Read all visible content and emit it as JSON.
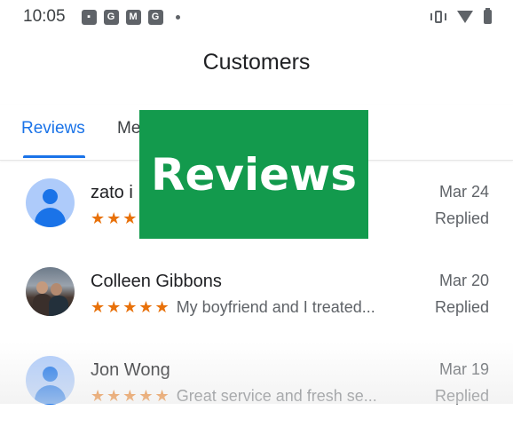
{
  "status_bar": {
    "time": "10:05",
    "notification_icons": [
      "image-icon",
      "google-icon",
      "gmail-icon",
      "google-icon"
    ]
  },
  "app": {
    "title": "Customers"
  },
  "tabs": [
    {
      "label": "Reviews",
      "selected": true
    },
    {
      "label": "Me",
      "selected": false
    }
  ],
  "reviews": [
    {
      "name": "zato i",
      "rating": 5,
      "stars_text": "★★★",
      "snippet": "",
      "date": "Mar 24",
      "status": "Replied",
      "avatar": "default"
    },
    {
      "name": "Colleen Gibbons",
      "rating": 5,
      "stars_text": "★★★★★",
      "snippet": "My boyfriend and I treated...",
      "date": "Mar 20",
      "status": "Replied",
      "avatar": "photo"
    },
    {
      "name": "Jon Wong",
      "rating": 5,
      "stars_text": "★★★★★",
      "snippet": "Great service and fresh se...",
      "date": "Mar 19",
      "status": "Replied",
      "avatar": "default"
    }
  ],
  "banner": {
    "text": "Reviews"
  },
  "colors": {
    "accent": "#1a73e8",
    "star": "#e8710a",
    "banner": "#139a4d"
  }
}
